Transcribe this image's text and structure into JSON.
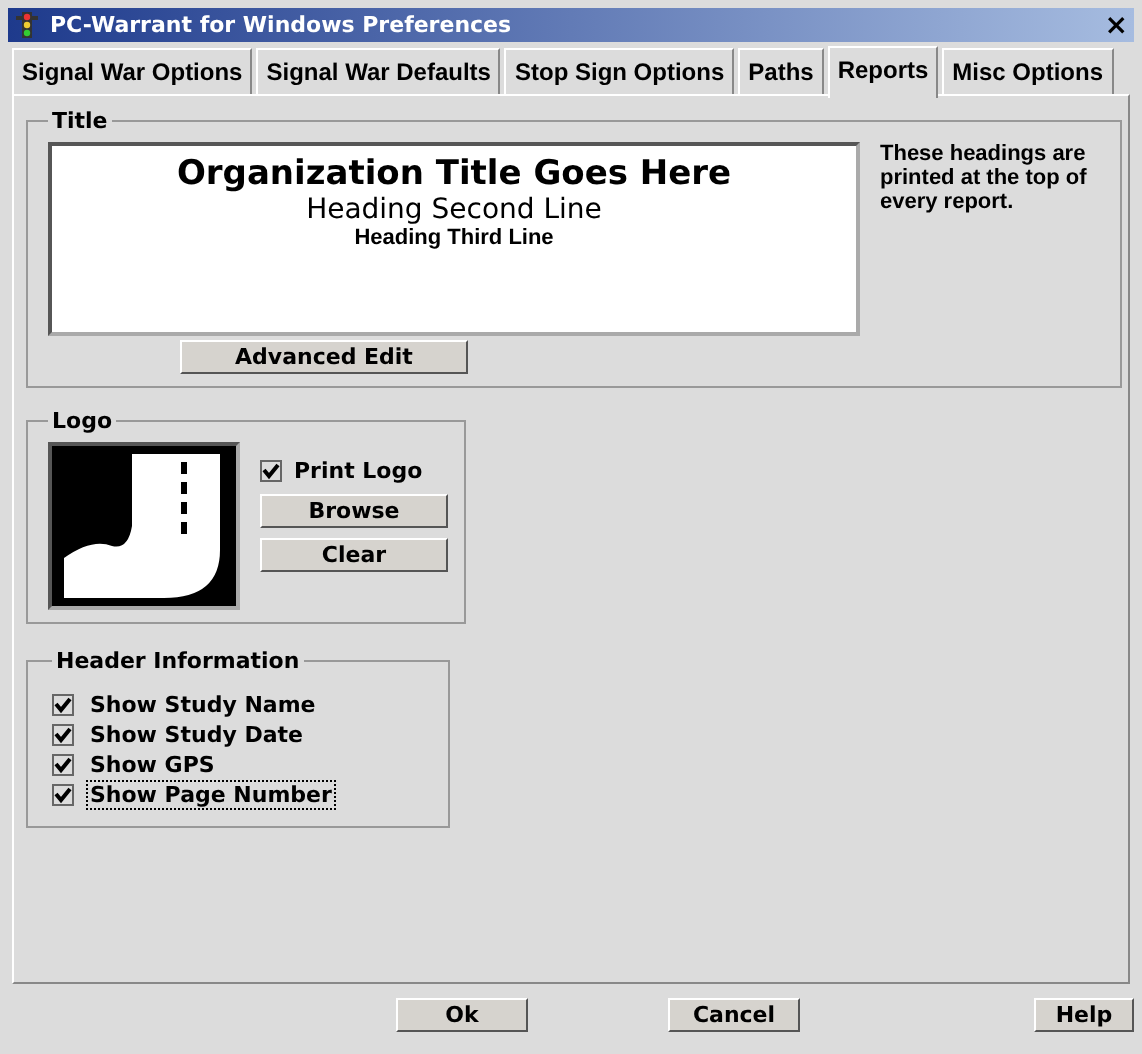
{
  "window": {
    "title": "PC-Warrant for Windows Preferences",
    "close": "×"
  },
  "tabs": [
    {
      "label": "Signal War Options",
      "selected": false
    },
    {
      "label": "Signal War Defaults",
      "selected": false
    },
    {
      "label": "Stop Sign Options",
      "selected": false
    },
    {
      "label": "Paths",
      "selected": false
    },
    {
      "label": "Reports",
      "selected": true
    },
    {
      "label": "Misc Options",
      "selected": false
    }
  ],
  "title_group": {
    "legend": "Title",
    "lines": [
      "Organization Title Goes Here",
      "Heading Second Line",
      "Heading Third Line"
    ],
    "note": "These headings are printed at the top of every report.",
    "button": "Advanced Edit"
  },
  "logo_group": {
    "legend": "Logo",
    "print_logo": {
      "label": "Print Logo",
      "checked": true
    },
    "buttons": [
      "Browse",
      "Clear"
    ]
  },
  "header_group": {
    "legend": "Header Information",
    "options": [
      {
        "label": "Show Study Name",
        "checked": true,
        "focused": false
      },
      {
        "label": "Show Study Date",
        "checked": true,
        "focused": false
      },
      {
        "label": "Show GPS",
        "checked": true,
        "focused": false
      },
      {
        "label": "Show Page Number",
        "checked": true,
        "focused": true
      }
    ]
  },
  "buttons": [
    "Ok",
    "Cancel",
    "Help"
  ]
}
